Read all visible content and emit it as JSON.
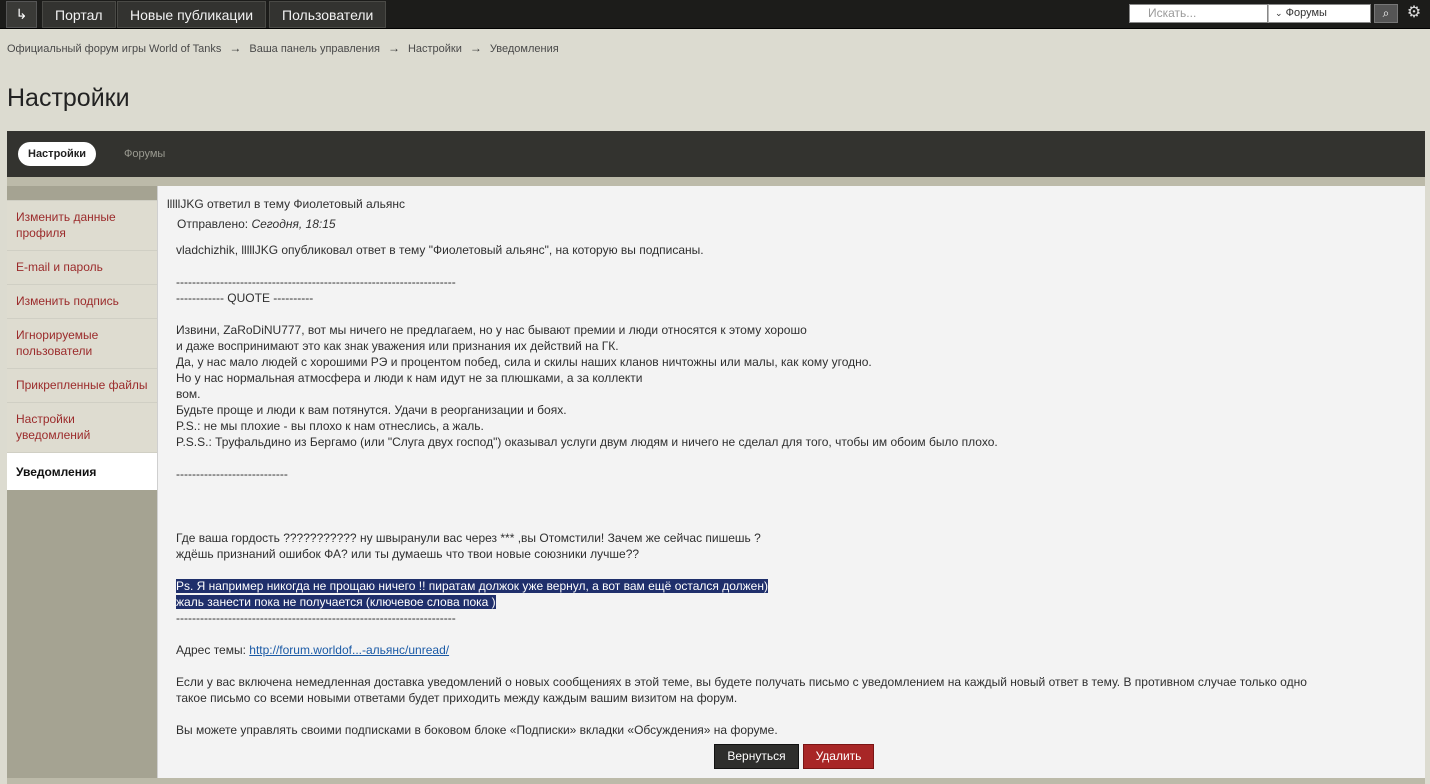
{
  "topnav": {
    "home_icon": "↳",
    "items": [
      "Портал",
      "Новые публикации",
      "Пользователи"
    ],
    "search_placeholder": "Искать...",
    "search_scope": "Форумы",
    "search_icon": "⌕",
    "gear_icon": "⚙"
  },
  "breadcrumb": [
    "Официальный форум игры World of Tanks",
    "Ваша панель управления",
    "Настройки",
    "Уведомления"
  ],
  "breadcrumb_sep": "→",
  "page_title": "Настройки",
  "tabs": {
    "active": "Настройки",
    "other": "Форумы"
  },
  "sidebar": {
    "items": [
      "Изменить данные профиля",
      "E-mail и пароль",
      "Изменить подпись",
      "Игнорируемые пользователи",
      "Прикрепленные файлы",
      "Настройки уведомлений"
    ],
    "active": "Уведомления"
  },
  "notification": {
    "title": "lllllJKG ответил в тему Фиолетовый альянс",
    "sent_label": "Отправлено:",
    "sent_time": "Сегодня, 18:15",
    "intro": "vladchizhik, lllllJKG опубликовал ответ в тему \"Фиолетовый альянс\", на которую вы подписаны.",
    "divider_long": "----------------------------------------------------------------------",
    "quote_header": "------------ QUOTE ----------",
    "quote_lines": [
      "Извини, ZaRoDiNU777, вот мы ничего не предлагаем, но у нас бывают премии и люди относятся к этому хорошо",
      "и даже воспринимают это как знак уважения или признания их действий на ГК.",
      "Да, у нас мало людей с хорошими РЭ и процентом побед, сила и скилы наших кланов ничтожны или малы, как кому угодно.",
      "Но у нас нормальная атмосфера и люди к нам идут не за плюшками, а за коллекти",
      "вом.",
      "Будьте проще и люди к вам потянутся. Удачи в реорганизации и боях.",
      "P.S.: не мы плохие - вы плохо к нам отнеслись, а жаль.",
      "P.S.S.: Труфальдино из Бергамо (или \"Слуга двух господ\") оказывал услуги двум людям и ничего не сделал для того, чтобы им обоим было плохо."
    ],
    "divider_short": "----------------------------",
    "reply_lines": [
      "Где ваша гордость ??????????? ну швыранули вас через *** ,вы  Отомстили! Зачем же сейчас  пишешь ?",
      "ждёшь признаний ошибок ФА?  или ты думаешь что твои новые союзники лучше??"
    ],
    "selected_lines": [
      "Ps.  Я  например никогда не прощаю  ничего !!  пиратам должок уже вернул, а вот вам ещё остался должен)",
      "жаль занести пока не получается (ключевое слова пока )"
    ],
    "topic_label": "Адрес темы:",
    "topic_link": "http://forum.worldof...-альянс/unread/",
    "info_line1": "Если у вас включена немедленная доставка уведомлений о новых сообщениях в этой теме, вы будете получать письмо с уведомлением на каждый новый ответ в тему. В противном случае только одно",
    "info_line2": "такое письмо со всеми новыми ответами будет приходить между каждым вашим визитом на форум.",
    "manage_line": "Вы можете управлять своими подписками в боковом блоке «Подписки» вкладки «Обсуждения» на форуме."
  },
  "buttons": {
    "back": "Вернуться",
    "delete": "Удалить"
  }
}
